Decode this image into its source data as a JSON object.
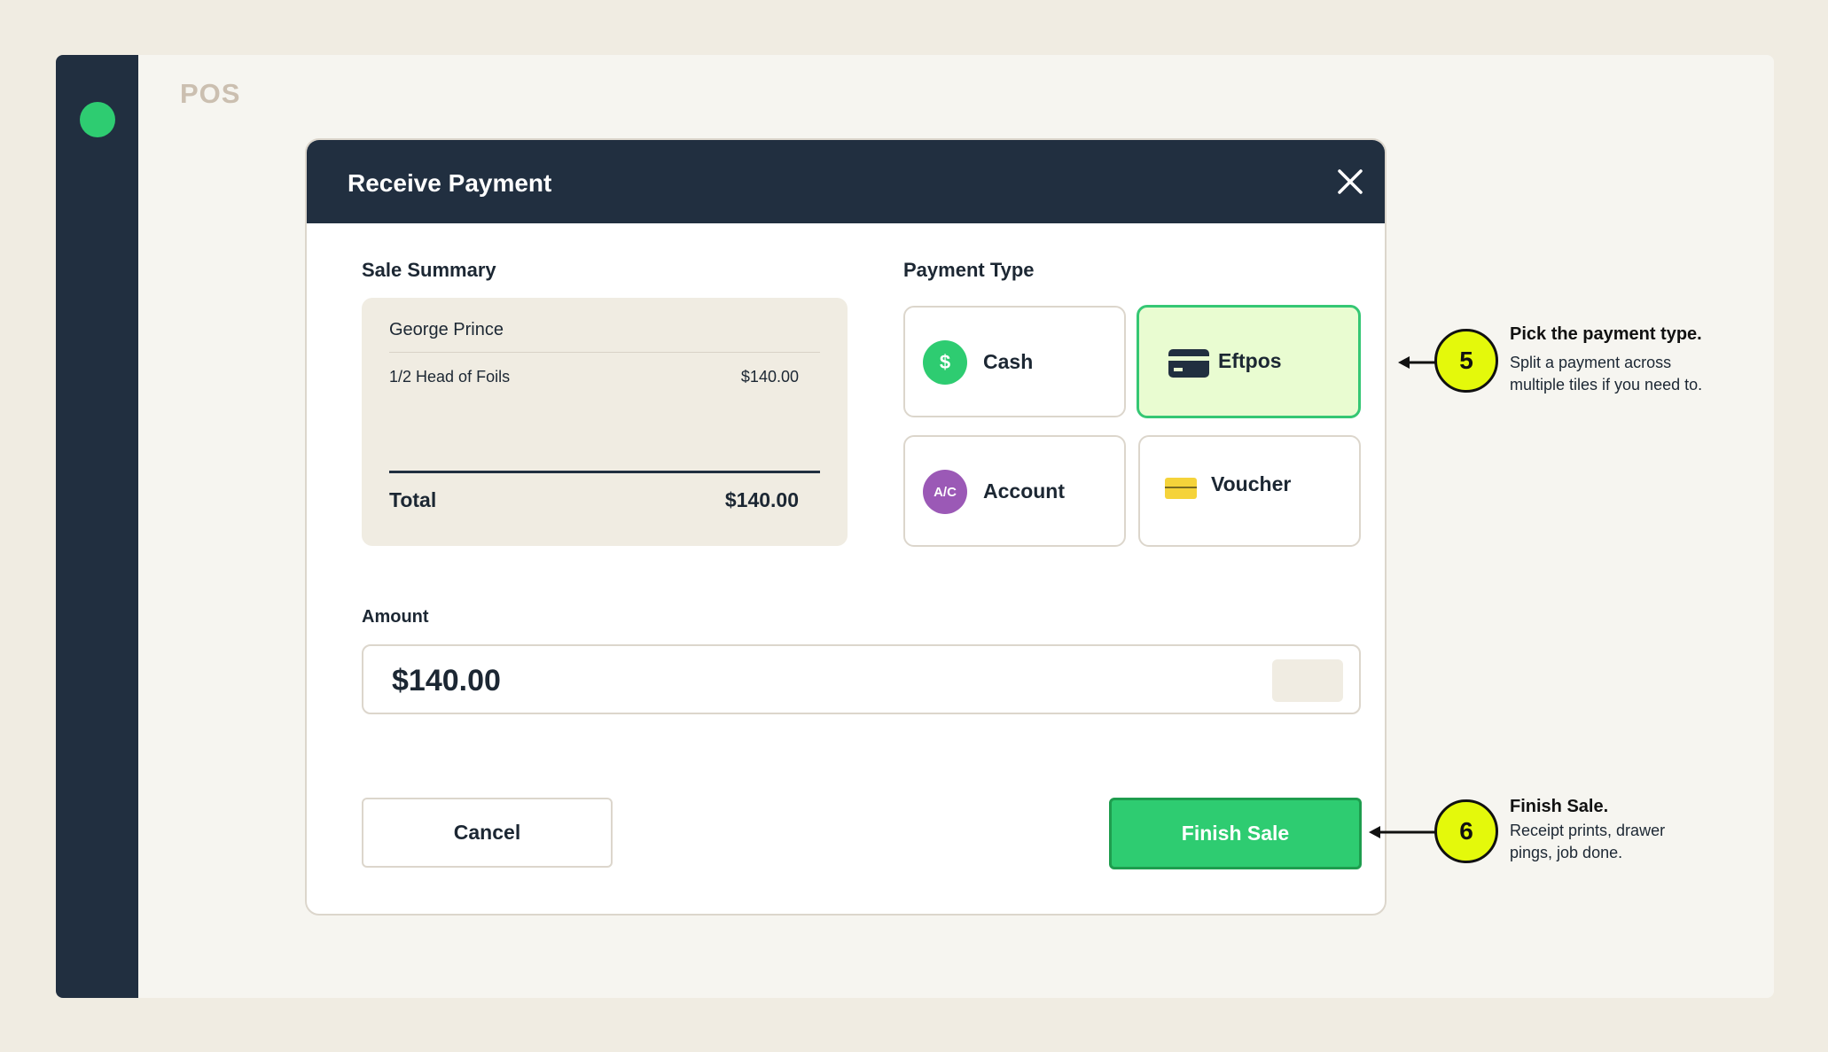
{
  "app": {
    "title": "POS"
  },
  "modal": {
    "title": "Receive Payment",
    "sale_summary": {
      "label": "Sale Summary",
      "customer": "George Prince",
      "lines": [
        {
          "name": "1/2 Head of Foils",
          "price": "$140.00"
        }
      ],
      "total_label": "Total",
      "total_value": "$140.00"
    },
    "payment_type": {
      "label": "Payment Type",
      "tiles": [
        {
          "label": "Cash",
          "icon": "dollar-icon",
          "icon_text": "$",
          "color": "#2ecc71",
          "selected": false
        },
        {
          "label": "Eftpos",
          "icon": "card-icon",
          "selected": true
        },
        {
          "label": "Account",
          "icon": "account-icon",
          "icon_text": "A/C",
          "color": "#9b59b6",
          "selected": false
        },
        {
          "label": "Voucher",
          "icon": "voucher-icon",
          "color": "#f5d33a",
          "selected": false
        }
      ]
    },
    "amount": {
      "label": "Amount",
      "value": "$140.00"
    },
    "buttons": {
      "cancel": "Cancel",
      "finish": "Finish Sale"
    }
  },
  "callouts": [
    {
      "number": "5",
      "title": "Pick the payment type.",
      "body": "Split a payment across multiple tiles if you need to."
    },
    {
      "number": "6",
      "title": "Finish Sale.",
      "body": "Receipt prints, drawer pings, job done."
    }
  ],
  "colors": {
    "accent": "#2ecc71",
    "navy": "#212f40",
    "callout": "#e4f90b",
    "selected_bg": "#e9fcd1"
  }
}
